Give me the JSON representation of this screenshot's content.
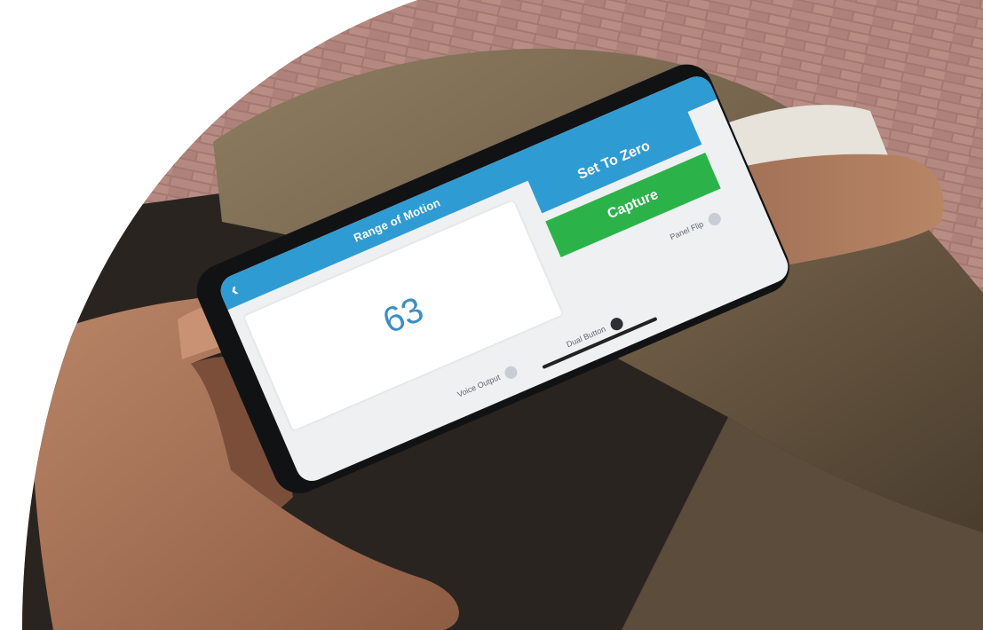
{
  "app": {
    "title": "Range of Motion",
    "back_icon": "chevron-left-icon",
    "reading": "63",
    "buttons": {
      "set_zero": "Set To Zero",
      "capture": "Capture"
    },
    "toggles": {
      "panel_flip": "Panel Flip",
      "dual_button": "Dual Button",
      "voice_output": "Voice Output"
    },
    "colors": {
      "header": "#2f9bd3",
      "set_zero": "#2f9bd3",
      "capture": "#2bb34a",
      "reading": "#3a8ec6"
    }
  }
}
